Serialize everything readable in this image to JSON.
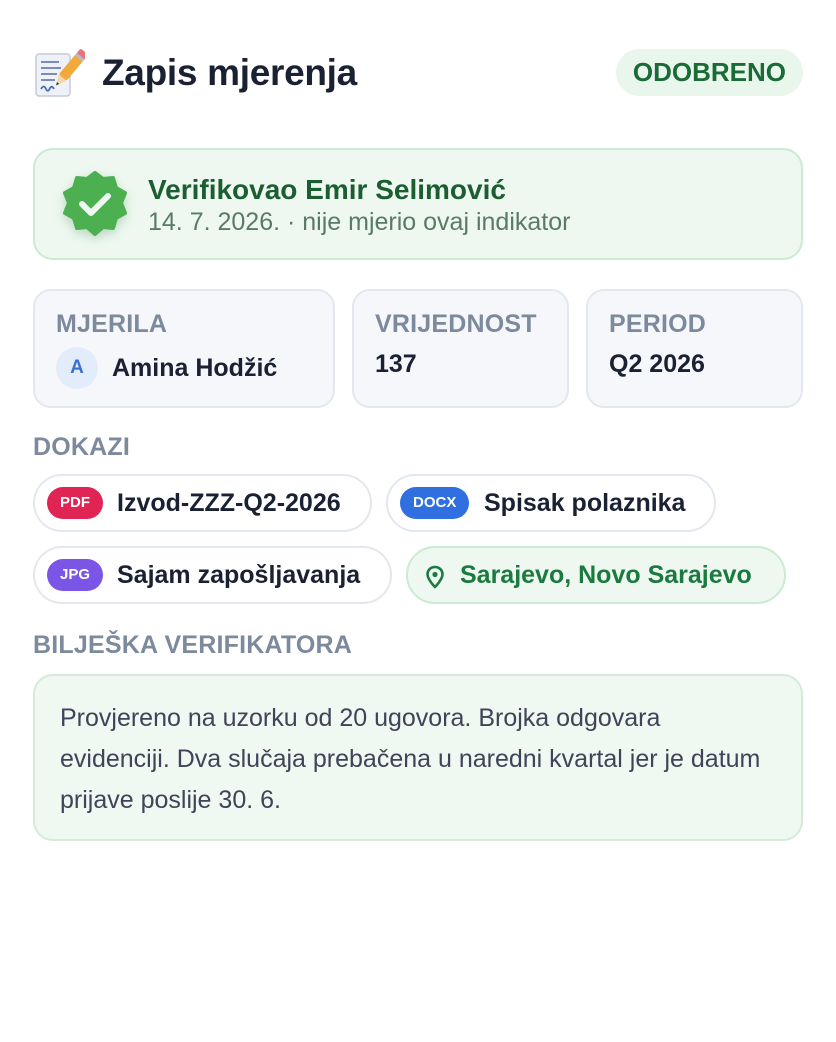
{
  "header": {
    "title": "Zapis mjerenja",
    "title_icon": "memo-icon",
    "status": "ODOBRENO"
  },
  "verification": {
    "title": "Verifikovao Emir Selimović",
    "subtitle": "14. 7. 2026. · nije mjerio ovaj indikator",
    "icon": "verified-badge-icon",
    "accent_color": "#4caf50"
  },
  "info": {
    "measured_by": {
      "label": "MJERILA",
      "avatar_initial": "A",
      "name": "Amina Hodžić"
    },
    "value": {
      "label": "VRIJEDNOST",
      "value": "137"
    },
    "period": {
      "label": "PERIOD",
      "value": "Q2 2026"
    }
  },
  "evidence": {
    "label": "DOKAZI",
    "items": [
      {
        "type": "PDF",
        "name": "Izvod-ZZZ-Q2-2026",
        "color": "#e02454"
      },
      {
        "type": "DOCX",
        "name": "Spisak polaznika",
        "color": "#2f6fe0"
      },
      {
        "type": "JPG",
        "name": "Sajam zapošljavanja",
        "color": "#7a55e6"
      }
    ],
    "location": {
      "icon": "map-pin-icon",
      "name": "Sarajevo, Novo Sarajevo"
    }
  },
  "note": {
    "label": "BILJEŠKA VERIFIKATORA",
    "text": "Provjereno na uzorku od 20 ugovora. Brojka odgovara evidenciji. Dva slučaja prebačena u naredni kvartal jer je datum prijave poslije 30. 6."
  }
}
